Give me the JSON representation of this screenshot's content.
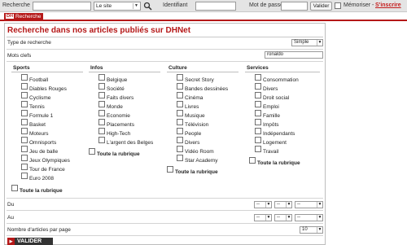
{
  "topbar": {
    "search_label": "Recherche",
    "site_select": "Le site",
    "identifiant_label": "Identifiant",
    "password_label": "Mot de passe",
    "valider_button": "Valider",
    "memoriser_label": "Mémoriser -",
    "inscrire_link": "S'inscrire"
  },
  "tab": {
    "logo": "DH",
    "label": "Recherche"
  },
  "page": {
    "title": "Recherche dans nos articles publiés sur DHNet",
    "type_label": "Type de recherche",
    "type_value": "Simple",
    "keywords_label": "Mots clefs",
    "keywords_value": "ronaldo",
    "du_label": "Du",
    "au_label": "Au",
    "per_page_label": "Nombre d'articles par page",
    "per_page_value": "10",
    "date_placeholder": "--",
    "valider_label": "VALIDER"
  },
  "columns": [
    {
      "heading": "Sports",
      "items": [
        "Football",
        "Diables Rouges",
        "Cyclisme",
        "Tennis",
        "Formule 1",
        "Basket",
        "Moteurs",
        "Omnisports",
        "Jeu de balle",
        "Jeux Olympiques",
        "Tour de France",
        "Euro 2008"
      ],
      "all_label": "Toute la rubrique"
    },
    {
      "heading": "Infos",
      "items": [
        "Belgique",
        "Société",
        "Faits divers",
        "Monde",
        "Economie",
        "Placements",
        "High-Tech",
        "L'argent des Belges"
      ],
      "all_label": "Toute la rubrique"
    },
    {
      "heading": "Culture",
      "items": [
        "Secret Story",
        "Bandes dessinées",
        "Cinéma",
        "Livres",
        "Musique",
        "Télévision",
        "People",
        "Divers",
        "Vidéo Room",
        "Star Academy"
      ],
      "all_label": "Toute la rubrique"
    },
    {
      "heading": "Services",
      "items": [
        "Consommation",
        "Divers",
        "Droit social",
        "Emploi",
        "Famille",
        "Impôts",
        "Indépendants",
        "Logement",
        "Travail"
      ],
      "all_label": "Toute la rubrique"
    }
  ],
  "colors": {
    "accent": "#b51818",
    "topbar": "#e4e4e4"
  }
}
